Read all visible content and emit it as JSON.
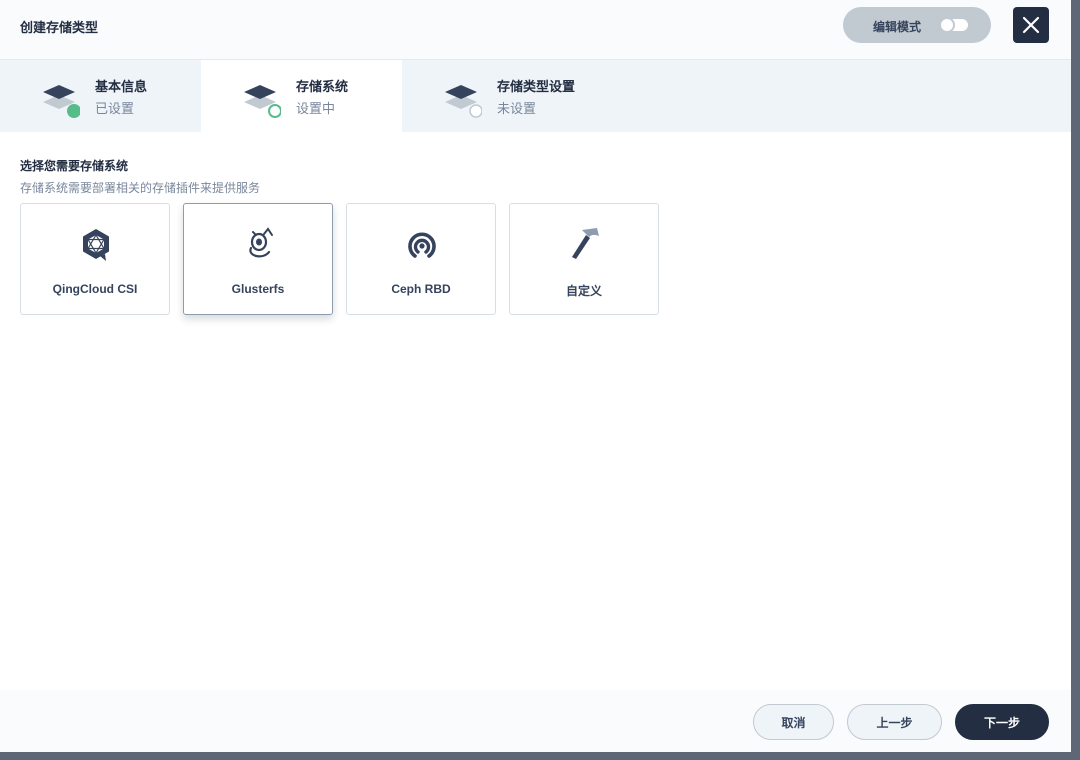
{
  "header": {
    "title": "创建存储类型",
    "edit_mode_label": "编辑模式",
    "close_icon": "close-icon"
  },
  "steps": [
    {
      "title": "基本信息",
      "status": "已设置",
      "state": "done"
    },
    {
      "title": "存储系统",
      "status": "设置中",
      "state": "active"
    },
    {
      "title": "存储类型设置",
      "status": "未设置",
      "state": "pending"
    }
  ],
  "content": {
    "title": "选择您需要存储系统",
    "description": "存储系统需要部署相关的存储插件来提供服务"
  },
  "cards": [
    {
      "label": "QingCloud CSI",
      "icon": "qingcloud-icon",
      "selected": false
    },
    {
      "label": "Glusterfs",
      "icon": "glusterfs-icon",
      "selected": true
    },
    {
      "label": "Ceph RBD",
      "icon": "ceph-icon",
      "selected": false
    },
    {
      "label": "自定义",
      "icon": "hammer-icon",
      "selected": false
    }
  ],
  "footer": {
    "cancel_label": "取消",
    "prev_label": "上一步",
    "next_label": "下一步"
  },
  "colors": {
    "primary": "#242e42",
    "success": "#55bc8a",
    "muted": "#79879c",
    "border": "#d8dee5"
  }
}
